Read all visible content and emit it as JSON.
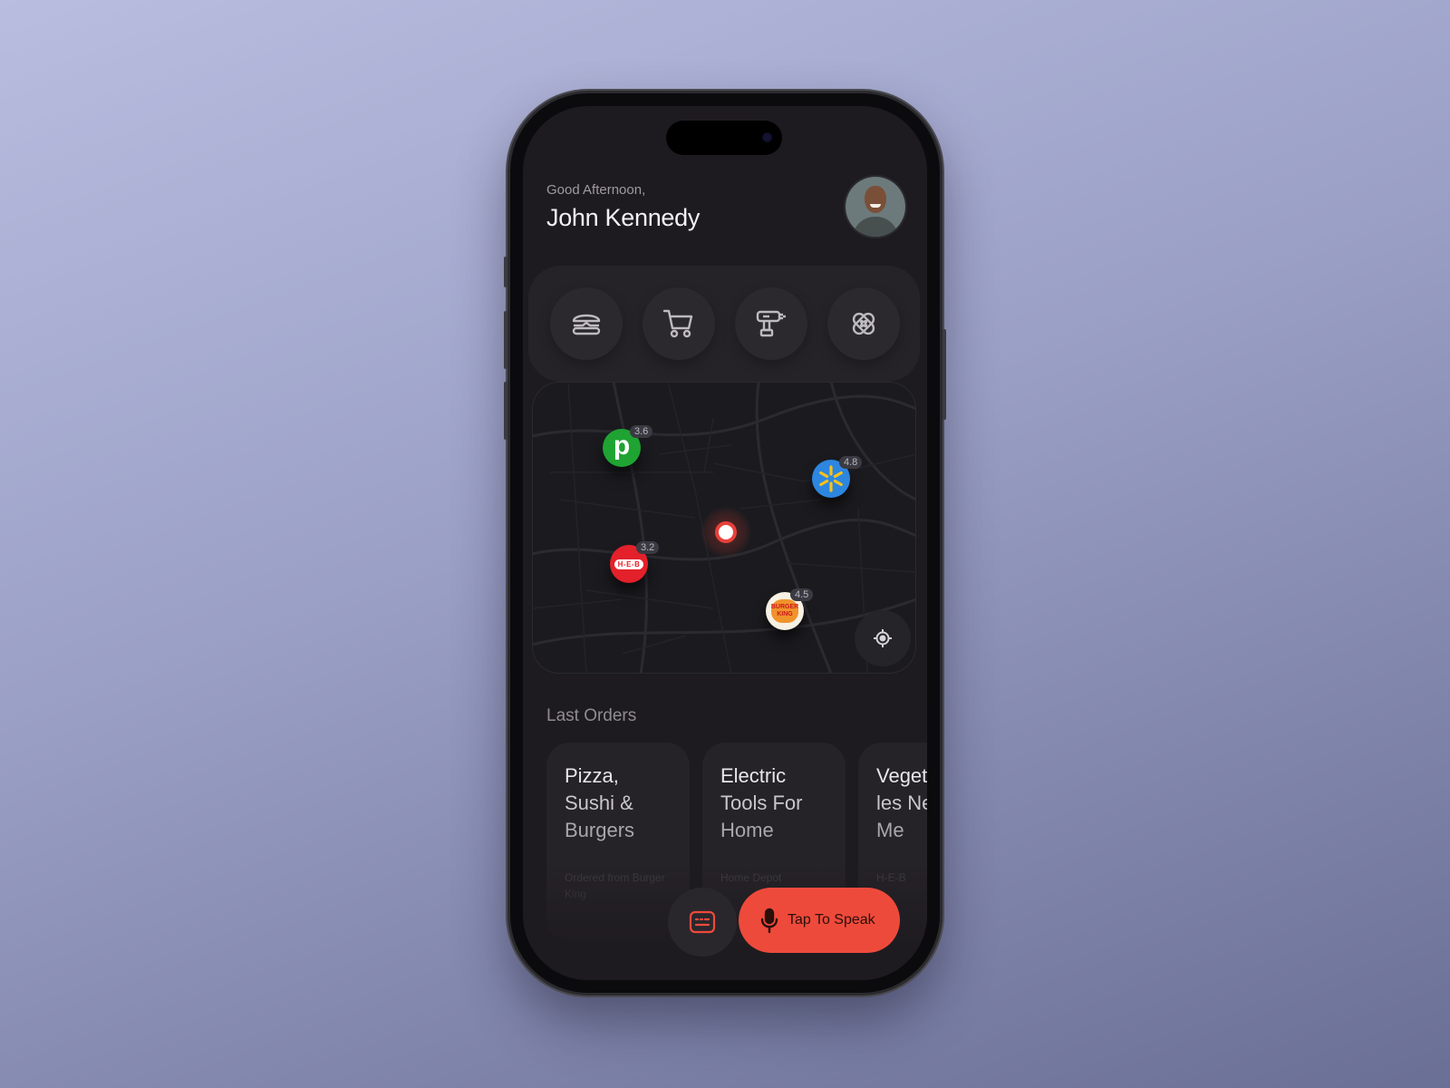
{
  "header": {
    "greeting": "Good Afternoon,",
    "user_name": "John Kennedy",
    "avatar_icon": "user-avatar"
  },
  "categories": [
    {
      "name": "food",
      "icon": "burger-icon"
    },
    {
      "name": "grocery",
      "icon": "shopping-cart-icon"
    },
    {
      "name": "tools",
      "icon": "drill-icon"
    },
    {
      "name": "pharmacy",
      "icon": "bandage-icon"
    }
  ],
  "map": {
    "stores": [
      {
        "name": "Publix",
        "logo_text": "p",
        "rating": "3.6",
        "color": "#1fa332"
      },
      {
        "name": "Walmart",
        "logo_text": "",
        "rating": "4.8",
        "color": "#2d86e0"
      },
      {
        "name": "H-E-B",
        "logo_text": "H-E-B",
        "rating": "3.2",
        "color": "#e4202b"
      },
      {
        "name": "Burger King",
        "logo_text": "BURGER KING",
        "rating": "4.5",
        "color": "#f7f1e4"
      }
    ],
    "current_location_icon": "location-dot-icon",
    "locate_icon": "crosshair-icon"
  },
  "last_orders": {
    "title": "Last Orders",
    "items": [
      {
        "lines": [
          "Pizza,",
          "Sushi &",
          "Burgers"
        ],
        "subtitle": "Ordered from Burger King"
      },
      {
        "lines": [
          "Electric",
          "Tools For",
          "Home"
        ],
        "subtitle": "Home Depot"
      },
      {
        "lines": [
          "Vegetab",
          "les Near",
          "Me"
        ],
        "subtitle": "H-E-B"
      }
    ]
  },
  "bottom_actions": {
    "keyboard_icon": "keyboard-icon",
    "speak_label": "Tap To Speak",
    "speak_icon": "microphone-icon"
  },
  "colors": {
    "accent": "#ee4a3b",
    "screen_bg": "#1e1b20"
  }
}
